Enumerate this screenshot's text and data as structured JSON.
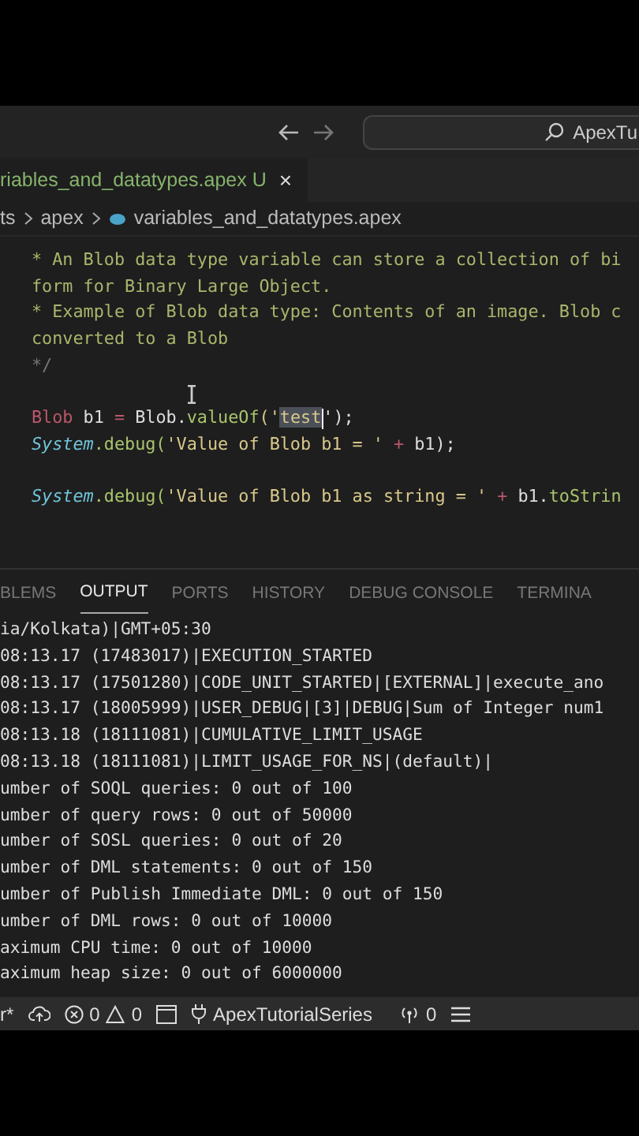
{
  "title_bar": {
    "search_text": "ApexTu"
  },
  "editor_tab": {
    "label": "riables_and_datatypes.apex",
    "badge": "U",
    "close": "×",
    "selected": true
  },
  "breadcrumbs": [
    "ts",
    "apex",
    "variables_and_datatypes.apex"
  ],
  "code_blocks": [
    [
      {
        "tokens": [
          {
            "text": "* An Blob data type variable can store a collection of bi",
            "kind": "comment"
          }
        ]
      },
      {
        "tokens": [
          {
            "text": "form for Binary Large Object.",
            "kind": "comment"
          }
        ]
      },
      {
        "tokens": [
          {
            "text": "* Example of Blob data type: Contents of an image. Blob c",
            "kind": "comment"
          }
        ]
      },
      {
        "tokens": [
          {
            "text": "converted to a Blob",
            "kind": "comment"
          }
        ]
      },
      {
        "tokens": [
          {
            "text": "*/",
            "kind": "comment-end"
          }
        ]
      }
    ],
    [
      {
        "tokens": [
          {
            "text": "Blob",
            "kind": "keyword"
          },
          {
            "text": " b1 ",
            "kind": "plain"
          },
          {
            "text": "=",
            "kind": "operator"
          },
          {
            "text": " Blob.",
            "kind": "plain"
          },
          {
            "text": "valueOf",
            "kind": "method"
          },
          {
            "text": "('",
            "kind": "string"
          },
          {
            "text": "test",
            "kind": "selection"
          },
          {
            "text": "');",
            "kind": "plain"
          }
        ]
      },
      {
        "tokens": [
          {
            "text": "System",
            "kind": "class"
          },
          {
            "text": ".debug(",
            "kind": "method"
          },
          {
            "text": "'Value of Blob b1 = '",
            "kind": "string"
          },
          {
            "text": " + ",
            "kind": "operator"
          },
          {
            "text": "b1);",
            "kind": "plain"
          }
        ]
      }
    ],
    [
      {
        "tokens": [
          {
            "text": "System",
            "kind": "class"
          },
          {
            "text": ".debug(",
            "kind": "method"
          },
          {
            "text": "'Value of Blob b1 as string = '",
            "kind": "string"
          },
          {
            "text": " + ",
            "kind": "operator"
          },
          {
            "text": "b1.",
            "kind": "plain"
          },
          {
            "text": "toStrin",
            "kind": "method"
          }
        ]
      }
    ]
  ],
  "panel_tabs": [
    {
      "label": "BLEMS",
      "selected": false
    },
    {
      "label": "OUTPUT",
      "selected": true
    },
    {
      "label": "PORTS",
      "selected": false
    },
    {
      "label": "HISTORY",
      "selected": false
    },
    {
      "label": "DEBUG CONSOLE",
      "selected": false
    },
    {
      "label": "TERMINA",
      "selected": false
    }
  ],
  "output_lines": [
    "ia/Kolkata)|GMT+05:30",
    "08:13.17 (17483017)|EXECUTION_STARTED",
    "08:13.17 (17501280)|CODE_UNIT_STARTED|[EXTERNAL]|execute_ano",
    "08:13.17 (18005999)|USER_DEBUG|[3]|DEBUG|Sum of Integer num1",
    "08:13.18 (18111081)|CUMULATIVE_LIMIT_USAGE",
    "08:13.18 (18111081)|LIMIT_USAGE_FOR_NS|(default)|",
    "umber of SOQL queries: 0 out of 100",
    "umber of query rows: 0 out of 50000",
    "umber of SOSL queries: 0 out of 20",
    "umber of DML statements: 0 out of 150",
    "umber of Publish Immediate DML: 0 out of 150",
    "umber of DML rows: 0 out of 10000",
    "aximum CPU time: 0 out of 10000",
    "aximum heap size: 0 out of 6000000"
  ],
  "status_bar": {
    "branch": "r*",
    "errors": "0",
    "warnings": "0",
    "org": "ApexTutorialSeries",
    "ports": "0"
  }
}
